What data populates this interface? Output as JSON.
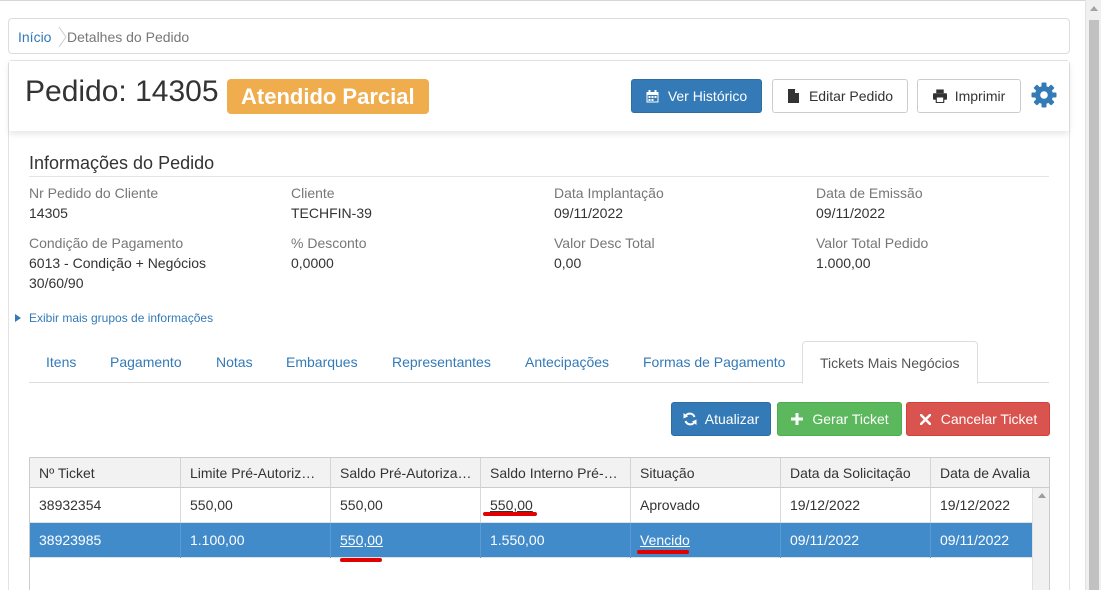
{
  "breadcrumb": {
    "home": "Início",
    "current": "Detalhes do Pedido"
  },
  "header": {
    "order_title": "Pedido: 14305",
    "status_badge": "Atendido Parcial",
    "buttons": {
      "history": "Ver Histórico",
      "edit": "Editar Pedido",
      "print": "Imprimir"
    }
  },
  "info": {
    "title": "Informações do Pedido",
    "fields": [
      {
        "label": "Nr Pedido do Cliente",
        "value": "14305"
      },
      {
        "label": "Cliente",
        "value": "TECHFIN-39"
      },
      {
        "label": "Data Implantação",
        "value": "09/11/2022"
      },
      {
        "label": "Data de Emissão",
        "value": "09/11/2022"
      },
      {
        "label": "Condição de Pagamento",
        "value_line1": "6013 - Condição + Negócios",
        "value_line2": "30/60/90"
      },
      {
        "label": "% Desconto",
        "value": "0,0000"
      },
      {
        "label": "Valor Desc Total",
        "value": "0,00"
      },
      {
        "label": "Valor Total Pedido",
        "value": "1.000,00"
      }
    ],
    "more_link": "Exibir mais grupos de informações"
  },
  "tabs": [
    {
      "label": "Itens"
    },
    {
      "label": "Pagamento"
    },
    {
      "label": "Notas"
    },
    {
      "label": "Embarques"
    },
    {
      "label": "Representantes"
    },
    {
      "label": "Antecipações"
    },
    {
      "label": "Formas de Pagamento"
    },
    {
      "label": "Tickets Mais Negócios",
      "active": true
    }
  ],
  "actions": {
    "refresh": "Atualizar",
    "generate": "Gerar Ticket",
    "cancel": "Cancelar Ticket"
  },
  "grid": {
    "columns": [
      "Nº Ticket",
      "Limite Pré-Autoriz…",
      "Saldo Pré-Autoriza…",
      "Saldo Interno Pré-…",
      "Situação",
      "Data da Solicitação",
      "Data de Avalia"
    ],
    "rows": [
      [
        "38932354",
        "550,00",
        "550,00",
        "550,00",
        "Aprovado",
        "19/12/2022",
        "19/12/2022"
      ],
      [
        "38923985",
        "1.100,00",
        "550,00",
        "1.550,00",
        "Vencido",
        "09/11/2022",
        "09/11/2022"
      ]
    ],
    "selected_row": 1
  },
  "colors": {
    "primary": "#337ab7",
    "warning": "#f0ad4e",
    "success": "#5cb85c",
    "danger": "#d9534f",
    "selected_row": "#428bca",
    "annotation": "#e00000"
  },
  "icons": [
    "calendar-icon",
    "document-icon",
    "printer-icon",
    "gear-icon",
    "refresh-icon",
    "plus-icon",
    "close-icon",
    "caret-right-icon"
  ]
}
